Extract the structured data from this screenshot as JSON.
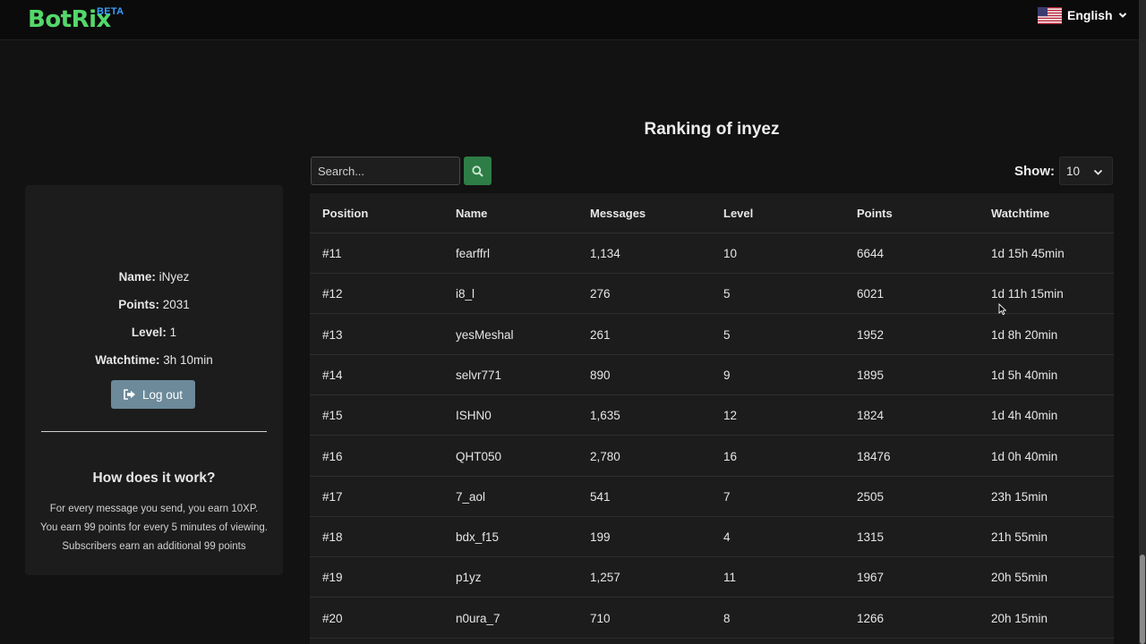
{
  "navbar": {
    "logo": "BotRix",
    "badge": "BETA",
    "language": "English",
    "flag_icon": "us-flag-icon"
  },
  "profile": {
    "name_label": "Name:",
    "name_value": "iNyez",
    "points_label": "Points:",
    "points_value": "2031",
    "level_label": "Level:",
    "level_value": "1",
    "watchtime_label": "Watchtime:",
    "watchtime_value": "3h 10min",
    "logout_label": "Log out"
  },
  "how": {
    "title": "How does it work?",
    "lines": [
      "For every message you send, you earn 10XP.",
      "You earn 99 points for every 5 minutes of viewing.",
      "Subscribers earn an additional 99 points"
    ]
  },
  "ranking": {
    "title": "Ranking of inyez",
    "search_placeholder": "Search...",
    "show_label": "Show:",
    "show_value": "10",
    "columns": [
      "Position",
      "Name",
      "Messages",
      "Level",
      "Points",
      "Watchtime"
    ],
    "rows": [
      [
        "#11",
        "fearffrl",
        "1,134",
        "10",
        "6644",
        "1d 15h 45min"
      ],
      [
        "#12",
        "i8_l",
        "276",
        "5",
        "6021",
        "1d 11h 15min"
      ],
      [
        "#13",
        "yesMeshal",
        "261",
        "5",
        "1952",
        "1d 8h 20min"
      ],
      [
        "#14",
        "selvr771",
        "890",
        "9",
        "1895",
        "1d 5h 40min"
      ],
      [
        "#15",
        "ISHN0",
        "1,635",
        "12",
        "1824",
        "1d 4h 40min"
      ],
      [
        "#16",
        "QHT050",
        "2,780",
        "16",
        "18476",
        "1d 0h 40min"
      ],
      [
        "#17",
        "7_aol",
        "541",
        "7",
        "2505",
        "23h 15min"
      ],
      [
        "#18",
        "bdx_f15",
        "199",
        "4",
        "1315",
        "21h 55min"
      ],
      [
        "#19",
        "p1yz",
        "1,257",
        "11",
        "1967",
        "20h 55min"
      ],
      [
        "#20",
        "n0ura_7",
        "710",
        "8",
        "1266",
        "20h 15min"
      ]
    ]
  },
  "colors": {
    "background": "#121212",
    "card": "#1c1c1c",
    "brand": "#53d86a",
    "badge": "#3aa0ff",
    "search_button": "#2e7d46",
    "logout_button": "#6c8a9a"
  }
}
